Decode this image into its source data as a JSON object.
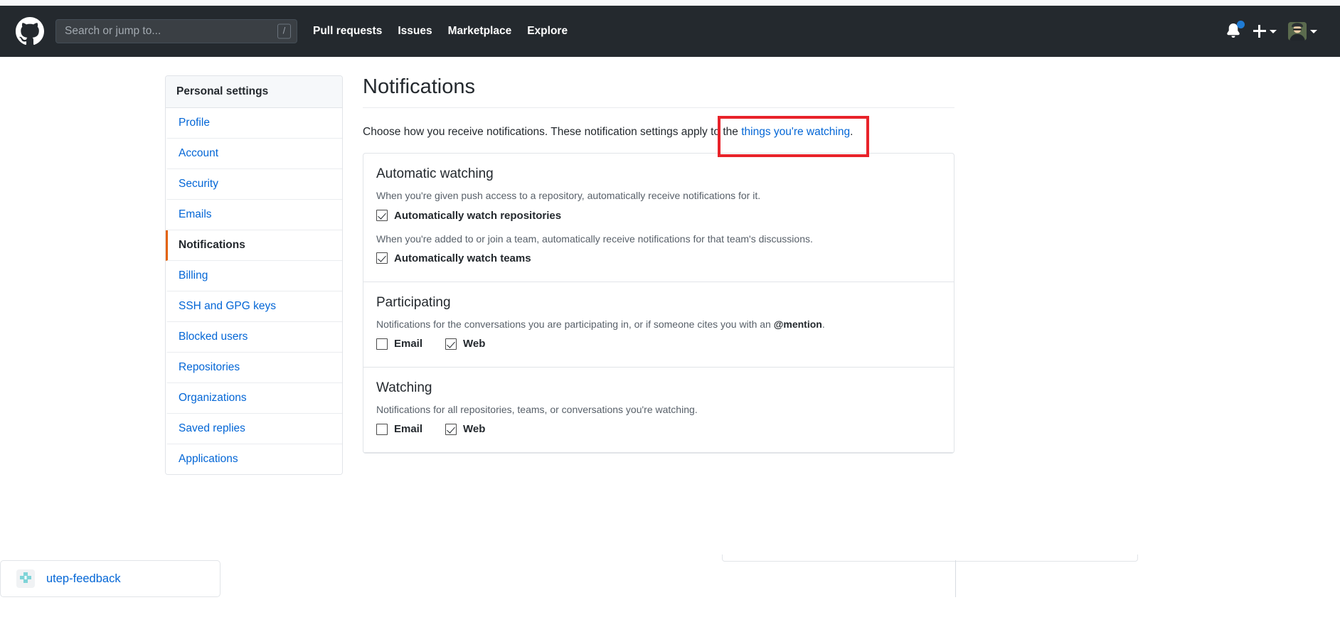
{
  "header": {
    "logo_icon": "github-octocat-logo",
    "search": {
      "placeholder": "Search or jump to...",
      "value": "",
      "shortcut_badge": "/"
    },
    "nav": [
      {
        "label": "Pull requests"
      },
      {
        "label": "Issues"
      },
      {
        "label": "Marketplace"
      },
      {
        "label": "Explore"
      }
    ],
    "notifications_icon": "bell-icon",
    "has_unread_notifications": true,
    "create_new_icon": "plus-icon",
    "avatar_icon": "user-avatar",
    "background_color": "#24292e"
  },
  "sidebar": {
    "title": "Personal settings",
    "items": [
      {
        "label": "Profile",
        "active": false
      },
      {
        "label": "Account",
        "active": false
      },
      {
        "label": "Security",
        "active": false
      },
      {
        "label": "Emails",
        "active": false
      },
      {
        "label": "Notifications",
        "active": true
      },
      {
        "label": "Billing",
        "active": false
      },
      {
        "label": "SSH and GPG keys",
        "active": false
      },
      {
        "label": "Blocked users",
        "active": false
      },
      {
        "label": "Repositories",
        "active": false
      },
      {
        "label": "Organizations",
        "active": false
      },
      {
        "label": "Saved replies",
        "active": false
      },
      {
        "label": "Applications",
        "active": false
      }
    ],
    "active_indicator_color": "#e36209",
    "link_color": "#0366d6"
  },
  "main": {
    "title": "Notifications",
    "intro_prefix": "Choose how you receive notifications. These notification settings apply to the ",
    "intro_link": "things you're watching",
    "intro_suffix": ".",
    "sections": [
      {
        "title": "Automatic watching",
        "desc_1": "When you're given push access to a repository, automatically receive notifications for it.",
        "checkbox_1": {
          "label": "Automatically watch repositories",
          "checked": true
        },
        "desc_2": "When you're added to or join a team, automatically receive notifications for that team's discussions.",
        "checkbox_2": {
          "label": "Automatically watch teams",
          "checked": true
        }
      },
      {
        "title": "Participating",
        "desc": "Notifications for the conversations you are participating in, or if someone cites you with an ",
        "desc_bold": "@mention",
        "desc_tail": ".",
        "email": {
          "label": "Email",
          "checked": false
        },
        "web": {
          "label": "Web",
          "checked": true
        }
      },
      {
        "title": "Watching",
        "desc": "Notifications for all repositories, teams, or conversations you're watching.",
        "email": {
          "label": "Email",
          "checked": false
        },
        "web": {
          "label": "Web",
          "checked": true
        }
      }
    ]
  },
  "annotation": {
    "color": "#e8232a",
    "target": "things you're watching"
  },
  "bottom_bar": {
    "repo_label": "utep-feedback",
    "repo_icon": "repo-avatar-icon"
  }
}
